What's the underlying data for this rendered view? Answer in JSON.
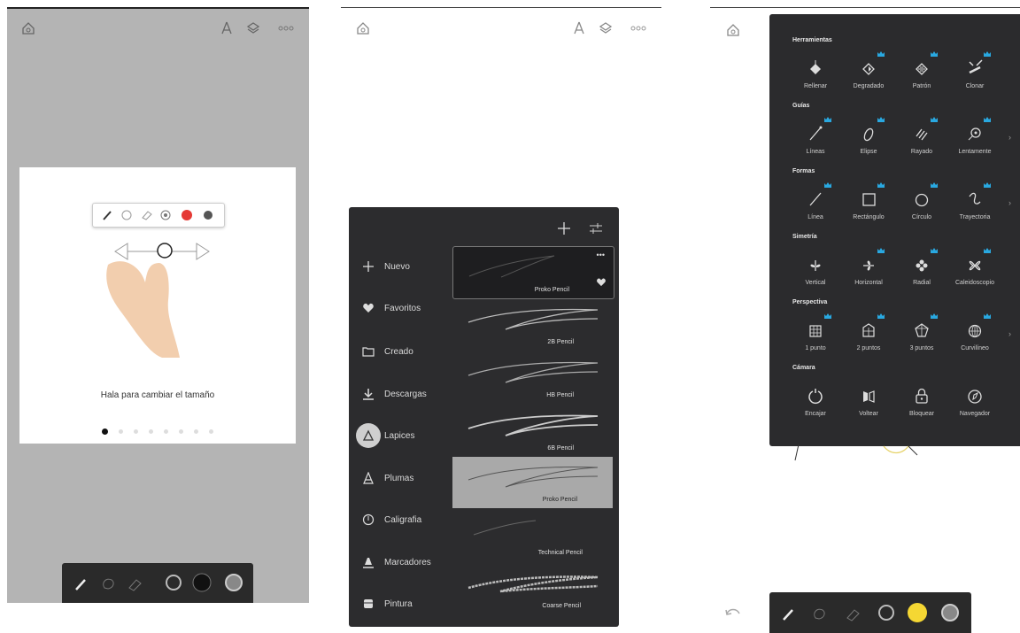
{
  "panel1": {
    "caption": "Hala para cambiar el tamaño",
    "page_dots": 8,
    "active_dot": 0,
    "accent_red": "#e53935",
    "icons": [
      "home-icon",
      "pen-tip-icon",
      "layers-icon",
      "more-icon"
    ]
  },
  "panel2": {
    "categories": [
      {
        "label": "Nuevo",
        "icon": "plus-icon"
      },
      {
        "label": "Favoritos",
        "icon": "heart-icon"
      },
      {
        "label": "Creado",
        "icon": "folder-icon"
      },
      {
        "label": "Descargas",
        "icon": "download-icon"
      },
      {
        "label": "Lapices",
        "icon": "pencil-tip-icon"
      },
      {
        "label": "Plumas",
        "icon": "pen-icon"
      },
      {
        "label": "Caligrafia",
        "icon": "calligraphy-icon"
      },
      {
        "label": "Marcadores",
        "icon": "marker-icon"
      },
      {
        "label": "Pintura",
        "icon": "paint-icon"
      }
    ],
    "active_category": "Lapices",
    "brushes": [
      {
        "name": "Proko Pencil"
      },
      {
        "name": "2B Pencil"
      },
      {
        "name": "HB Pencil"
      },
      {
        "name": "6B Pencil"
      },
      {
        "name": "Proko Pencil"
      },
      {
        "name": "Technical Pencil"
      },
      {
        "name": "Coarse Pencil"
      }
    ],
    "more_label": "•••"
  },
  "panel3": {
    "sections": {
      "herramientas": "Herramientas",
      "guias": "Guías",
      "formas": "Formas",
      "simetria": "Simetría",
      "perspectiva": "Perspectiva",
      "camara": "Cámara"
    },
    "tools": {
      "herramientas": [
        "Rellenar",
        "Degradado",
        "Patrón",
        "Clonar"
      ],
      "guias": [
        "Líneas",
        "Elipse",
        "Rayado",
        "Lentamente"
      ],
      "formas": [
        "Línea",
        "Rectángulo",
        "Círculo",
        "Trayectoria"
      ],
      "simetria": [
        "Vertical",
        "Horizontal",
        "Radial",
        "Caleidoscopio"
      ],
      "perspectiva": [
        "1 punto",
        "2 puntos",
        "3 puntos",
        "Curvilíneo"
      ],
      "camara": [
        "Encajar",
        "Voltear",
        "Bloquear",
        "Navegador"
      ]
    },
    "crown_color": "#29a8e0",
    "accent_yellow": "#f5d733"
  }
}
